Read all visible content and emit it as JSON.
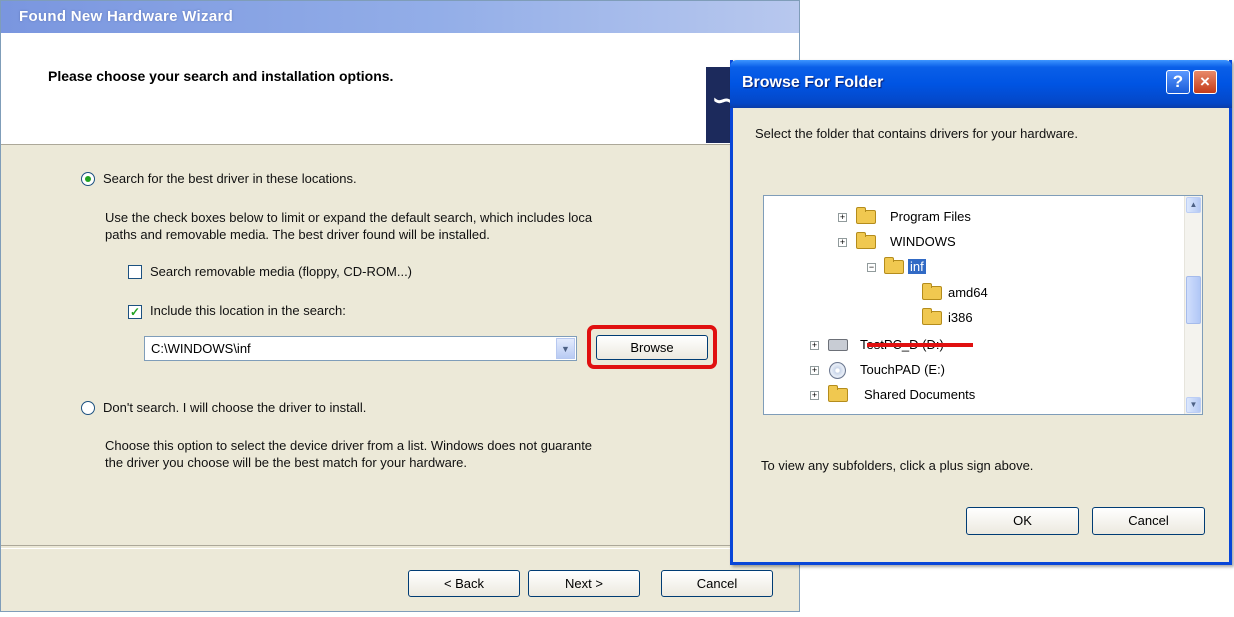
{
  "wizard": {
    "title": "Found New Hardware Wizard",
    "heading": "Please choose your search and installation options.",
    "option_search": {
      "label": "Search for the best driver in these locations.",
      "desc_line1": "Use the check boxes below to limit or expand the default search, which includes loca",
      "desc_line2": "paths and removable media. The best driver found will be installed.",
      "selected": true
    },
    "check_removable": {
      "label": "Search removable media (floppy, CD-ROM...)",
      "checked": false
    },
    "check_location": {
      "label": "Include this location in the search:",
      "checked": true
    },
    "location_value": "C:\\WINDOWS\\inf",
    "browse_label": "Browse",
    "option_manual": {
      "label": "Don't search. I will choose the driver to install.",
      "desc_line1": "Choose this option to select the device driver from a list.  Windows does not guarante",
      "desc_line2": "the driver you choose will be the best match for your hardware.",
      "selected": false
    },
    "back_label": "< Back",
    "next_label": "Next >",
    "cancel_label": "Cancel"
  },
  "browse_dialog": {
    "title": "Browse For Folder",
    "help_glyph": "?",
    "close_glyph": "×",
    "instruction": "Select the folder that contains drivers for your hardware.",
    "tree": {
      "program_files": "Program Files",
      "windows": "WINDOWS",
      "inf": "inf",
      "amd64": "amd64",
      "i386": "i386",
      "testpc_d": "TestPC_D (D:)",
      "touchpad_e": "TouchPAD (E:)",
      "shared_documents": "Shared Documents"
    },
    "hint": "To view any subfolders, click a plus sign above.",
    "ok_label": "OK",
    "cancel_label": "Cancel"
  },
  "colors": {
    "highlight_annotation": "#e01010",
    "selection": "#316ac5",
    "title_blue": "#0054e3"
  }
}
